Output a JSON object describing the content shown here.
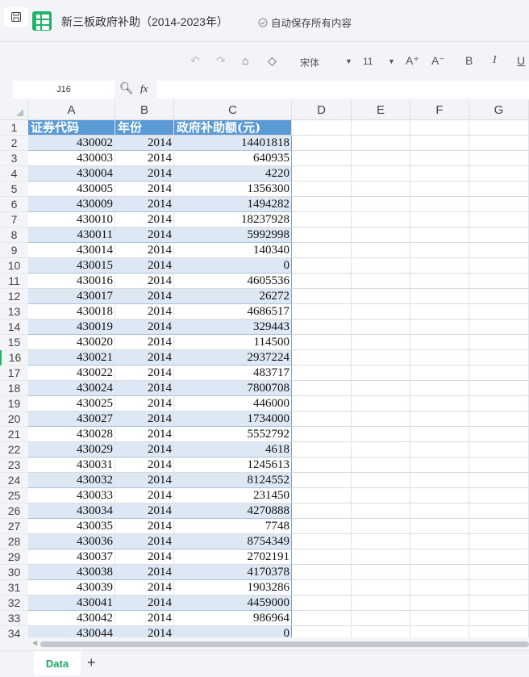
{
  "app": {
    "title": "新三板政府补助（2014-2023年）",
    "autosave": "自动保存所有内容"
  },
  "toolbar": {
    "font": "宋体",
    "font_size": "11",
    "bold": "B",
    "italic": "I",
    "underline": "U",
    "grow": "A⁺",
    "shrink": "A⁻"
  },
  "formula_bar": {
    "cell_ref": "J16",
    "fx": "fx",
    "value": ""
  },
  "columns": [
    "A",
    "B",
    "C",
    "D",
    "E",
    "F",
    "G"
  ],
  "headers": [
    "证券代码",
    "年份",
    "政府补助额(元)"
  ],
  "rows": [
    [
      "430002",
      "2014",
      "14401818"
    ],
    [
      "430003",
      "2014",
      "640935"
    ],
    [
      "430004",
      "2014",
      "4220"
    ],
    [
      "430005",
      "2014",
      "1356300"
    ],
    [
      "430009",
      "2014",
      "1494282"
    ],
    [
      "430010",
      "2014",
      "18237928"
    ],
    [
      "430011",
      "2014",
      "5992998"
    ],
    [
      "430014",
      "2014",
      "140340"
    ],
    [
      "430015",
      "2014",
      "0"
    ],
    [
      "430016",
      "2014",
      "4605536"
    ],
    [
      "430017",
      "2014",
      "26272"
    ],
    [
      "430018",
      "2014",
      "4686517"
    ],
    [
      "430019",
      "2014",
      "329443"
    ],
    [
      "430020",
      "2014",
      "114500"
    ],
    [
      "430021",
      "2014",
      "2937224"
    ],
    [
      "430022",
      "2014",
      "483717"
    ],
    [
      "430024",
      "2014",
      "7800708"
    ],
    [
      "430025",
      "2014",
      "446000"
    ],
    [
      "430027",
      "2014",
      "1734000"
    ],
    [
      "430028",
      "2014",
      "5552792"
    ],
    [
      "430029",
      "2014",
      "4618"
    ],
    [
      "430031",
      "2014",
      "1245613"
    ],
    [
      "430032",
      "2014",
      "8124552"
    ],
    [
      "430033",
      "2014",
      "231450"
    ],
    [
      "430034",
      "2014",
      "4270888"
    ],
    [
      "430035",
      "2014",
      "7748"
    ],
    [
      "430036",
      "2014",
      "8754349"
    ],
    [
      "430037",
      "2014",
      "2702191"
    ],
    [
      "430038",
      "2014",
      "4170378"
    ],
    [
      "430039",
      "2014",
      "1903286"
    ],
    [
      "430041",
      "2014",
      "4459000"
    ],
    [
      "430042",
      "2014",
      "986964"
    ],
    [
      "430044",
      "2014",
      "0"
    ]
  ],
  "active_row": 16,
  "sheets": [
    {
      "label": "Data",
      "active": true
    }
  ],
  "add_sheet": "+",
  "colors": {
    "header_fill": "#5b9bd5",
    "band_fill": "#dde8f4",
    "accent": "#1fb36a"
  }
}
